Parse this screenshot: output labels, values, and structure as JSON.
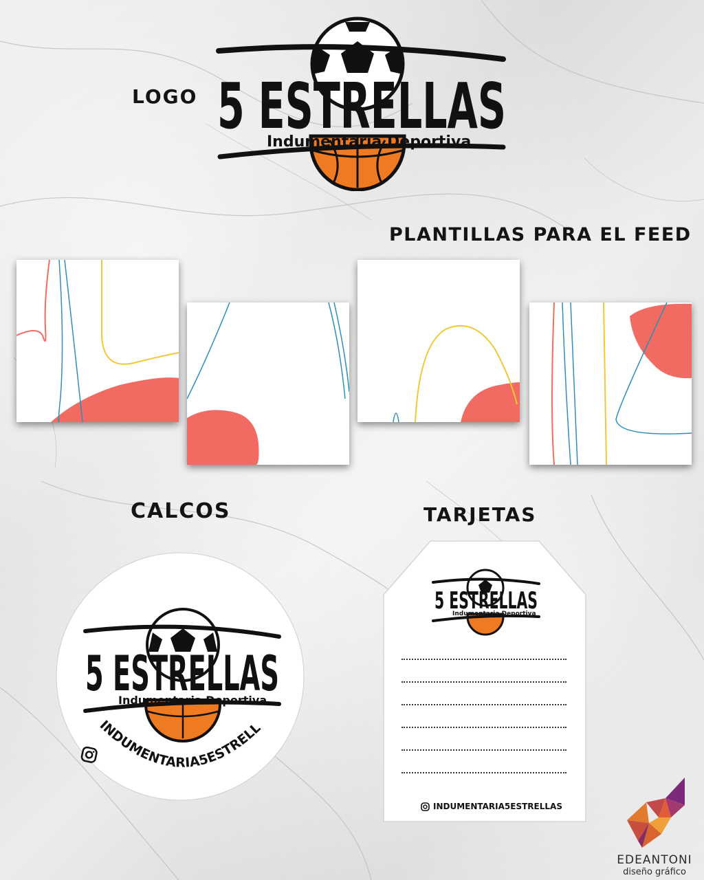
{
  "headings": {
    "logo": "LOGO",
    "feed": "PLANTILLAS PARA EL FEED",
    "calcos": "CALCOS",
    "tarjetas": "TARJETAS"
  },
  "logo": {
    "title": "5 ESTRELLAS",
    "subtitle": "Indumentaria Deportiva"
  },
  "social": {
    "icon": "instagram-icon",
    "handle": "INDUMENTARIA5ESTRELLAS"
  },
  "brand": {
    "name": "EDEANTONI",
    "tagline": "diseño gráfico"
  },
  "colors": {
    "coral": "#f26b63",
    "blue": "#2b8fb8",
    "yellow": "#f2c73a",
    "orange": "#ee7a22",
    "ink": "#141414"
  }
}
